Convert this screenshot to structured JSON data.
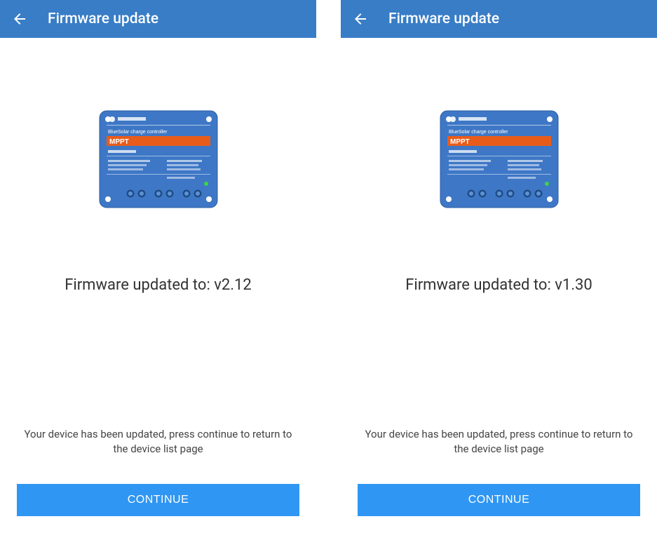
{
  "colors": {
    "appbar": "#387dc6",
    "button": "#2f96f3",
    "device_body": "#3e77c6",
    "device_band": "#e85c1b"
  },
  "screens": [
    {
      "header": {
        "title": "Firmware update"
      },
      "device": {
        "brand_line": "BlueSolar charge controller",
        "model": "MPPT"
      },
      "updated_label": "Firmware updated to: v2.12",
      "instruction": "Your device has been updated, press continue to return to the device list page",
      "continue_label": "CONTINUE"
    },
    {
      "header": {
        "title": "Firmware update"
      },
      "device": {
        "brand_line": "BlueSolar charge controller",
        "model": "MPPT"
      },
      "updated_label": "Firmware updated to: v1.30",
      "instruction": "Your device has been updated, press continue to return to the device list page",
      "continue_label": "CONTINUE"
    }
  ]
}
